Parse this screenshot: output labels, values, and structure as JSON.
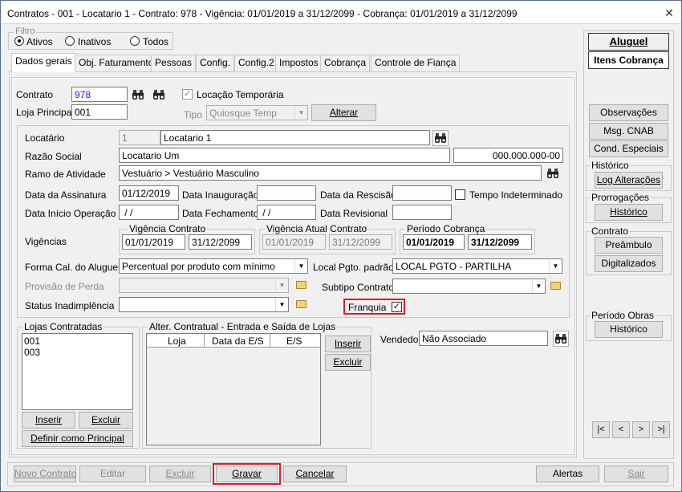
{
  "window": {
    "title": "Contratos - 001 - Locatario 1 - Contrato: 978 - Vigência: 01/01/2019 a 31/12/2099 - Cobrança: 01/01/2019 a 31/12/2099",
    "close_glyph": "✕"
  },
  "filter": {
    "caption": "Filtro",
    "options": [
      "Ativos",
      "Inativos",
      "Todos"
    ],
    "selected": "Ativos"
  },
  "tabs": [
    "Dados gerais",
    "Obj. Faturamento",
    "Pessoas",
    "Config.",
    "Config.2",
    "Impostos",
    "Cobrança",
    "Controle de Fiança"
  ],
  "active_tab": "Dados gerais",
  "contract": {
    "contrato_label": "Contrato",
    "contrato_value": "978",
    "loja_label": "Loja Principal",
    "loja_value": "001",
    "locacao_temporaria": "Locação Temporária",
    "tipo_label": "Tipo",
    "tipo_value": "Quiosque Temp",
    "alterar": "Alterar"
  },
  "details": {
    "locatario_label": "Locatário",
    "locatario_code": "1",
    "locatario_name": "Locatario 1",
    "razao_label": "Razão Social",
    "razao_value": "Locatario Um",
    "cnpj": "000.000.000-00",
    "ramo_label": "Ramo de Atividade",
    "ramo_value": "Vestuário > Vestuário Masculino",
    "assinatura_label": "Data da Assinatura",
    "assinatura_value": "01/12/2019",
    "inauguracao_label": "Data Inauguração",
    "inauguracao_value": "",
    "rescisao_label": "Data da Rescisão",
    "rescisao_value": "",
    "tempo_label": "Tempo Indeterminado",
    "inicio_label": "Data Início Operação",
    "inicio_value": " / /",
    "fechamento_label": "Data Fechamento",
    "fechamento_value": " / /",
    "revisional_label": "Data Revisional",
    "revisional_value": "",
    "vigencias_label": "Vigências",
    "vig_contrato_caption": "Vigência Contrato",
    "vig_contrato_start": "01/01/2019",
    "vig_contrato_end": "31/12/2099",
    "vig_atual_caption": "Vigência Atual Contrato",
    "vig_atual_start": "01/01/2019",
    "vig_atual_end": "31/12/2099",
    "periodo_caption": "Período Cobrança",
    "periodo_start": "01/01/2019",
    "periodo_end": "31/12/2099",
    "forma_label": "Forma Cal. do Aluguel",
    "forma_value": "Percentual por produto com mínimo",
    "local_label": "Local Pgto. padrão",
    "local_value": "LOCAL PGTO - PARTILHA",
    "provisao_label": "Provisão de Perda",
    "provisao_value": "",
    "subtipo_label": "Subtipo Contrato",
    "subtipo_value": "",
    "status_label": "Status Inadimplência",
    "status_value": "",
    "franquia_label": "Franquia"
  },
  "lojas": {
    "caption": "Lojas Contratadas",
    "items": [
      "001",
      "003"
    ],
    "inserir": "Inserir",
    "excluir": "Excluir",
    "definir": "Definir como Principal"
  },
  "alter": {
    "caption": "Alter. Contratual - Entrada e Saída de Lojas",
    "columns": [
      "Loja",
      "Data da E/S",
      "E/S"
    ],
    "inserir": "Inserir",
    "excluir": "Excluir"
  },
  "vendedor": {
    "label": "Vendedor",
    "value": "Não Associado"
  },
  "right_panel": {
    "aluguel": "Aluguel",
    "itens_cobranca": "Itens Cobrança",
    "observacoes": "Observações",
    "msg_cnab": "Msg. CNAB",
    "cond_especiais": "Cond. Especiais",
    "historico_caption": "Histórico",
    "log_alteracoes": "Log Alterações",
    "prorrogacoes_caption": "Prorrogações",
    "prorrogacoes_historico": "Histórico",
    "contrato_caption": "Contrato",
    "preambulo": "Preâmbulo",
    "digitalizados": "Digitalizados",
    "obras_caption": "Período Obras",
    "obras_historico": "Histórico",
    "nav": [
      "|<",
      "<",
      ">",
      ">|"
    ]
  },
  "bottom": {
    "novo": "Novo Contrato",
    "editar": "Editar",
    "excluir": "Excluir",
    "gravar": "Gravar",
    "cancelar": "Cancelar",
    "alertas": "Alertas",
    "sair": "Sair"
  },
  "colors": {
    "highlight_red": "#d0202a",
    "contract_blue": "#1a1aff"
  }
}
